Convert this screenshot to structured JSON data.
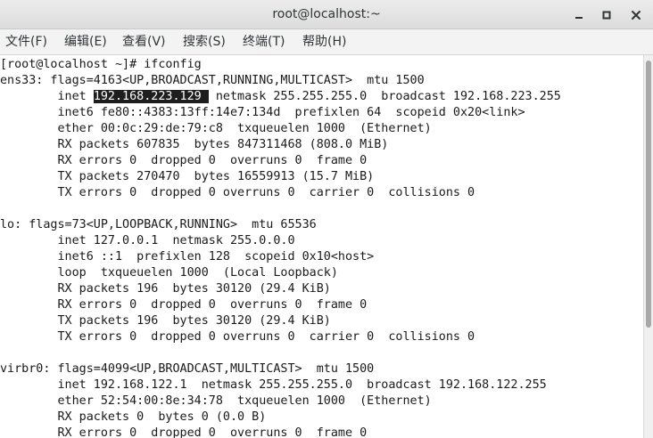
{
  "window": {
    "title": "root@localhost:~"
  },
  "menu": [
    "文件(F)",
    "编辑(E)",
    "查看(V)",
    "搜索(S)",
    "终端(T)",
    "帮助(H)"
  ],
  "terminal": {
    "lines": [
      "[root@localhost ~]# ifconfig",
      "ens33: flags=4163<UP,BROADCAST,RUNNING,MULTICAST>  mtu 1500",
      "        inet ",
      "        inet6 fe80::4383:13ff:14e7:134d  prefixlen 64  scopeid 0x20<link>",
      "        ether 00:0c:29:de:79:c8  txqueuelen 1000  (Ethernet)",
      "        RX packets 607835  bytes 847311468 (808.0 MiB)",
      "        RX errors 0  dropped 0  overruns 0  frame 0",
      "        TX packets 270470  bytes 16559913 (15.7 MiB)",
      "        TX errors 0  dropped 0 overruns 0  carrier 0  collisions 0",
      "",
      "lo: flags=73<UP,LOOPBACK,RUNNING>  mtu 65536",
      "        inet 127.0.0.1  netmask 255.0.0.0",
      "        inet6 ::1  prefixlen 128  scopeid 0x10<host>",
      "        loop  txqueuelen 1000  (Local Loopback)",
      "        RX packets 196  bytes 30120 (29.4 KiB)",
      "        RX errors 0  dropped 0  overruns 0  frame 0",
      "        TX packets 196  bytes 30120 (29.4 KiB)",
      "        TX errors 0  dropped 0 overruns 0  carrier 0  collisions 0",
      "",
      "virbr0: flags=4099<UP,BROADCAST,MULTICAST>  mtu 1500",
      "        inet 192.168.122.1  netmask 255.255.255.0  broadcast 192.168.122.255",
      "        ether 52:54:00:8e:34:78  txqueuelen 1000  (Ethernet)",
      "        RX packets 0  bytes 0 (0.0 B)",
      "        RX errors 0  dropped 0  overruns 0  frame 0"
    ],
    "selected_text": "192.168.223.129 ",
    "line3_rest": " netmask 255.255.255.0  broadcast 192.168.223.255"
  },
  "colors": {
    "selection_bg": "#1e1e1e",
    "selection_fg": "#ffffff",
    "terminal_fg": "#1a1a1a",
    "terminal_bg": "#ffffff"
  },
  "icons": {
    "minimize": "minimize-icon",
    "maximize": "maximize-icon",
    "close": "close-icon"
  }
}
